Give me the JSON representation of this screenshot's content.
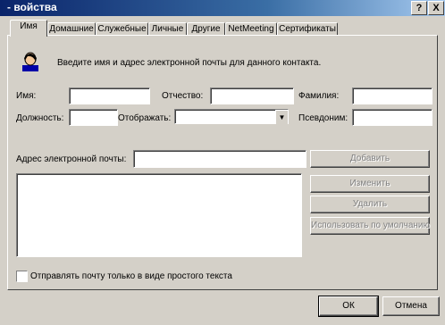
{
  "window": {
    "title": "- войства"
  },
  "titlebar_buttons": {
    "help": "?",
    "close": "X"
  },
  "tabs": [
    {
      "label": "Имя",
      "active": true
    },
    {
      "label": "Домашние"
    },
    {
      "label": "Служебные"
    },
    {
      "label": "Личные"
    },
    {
      "label": "Другие"
    },
    {
      "label": "NetMeeting"
    },
    {
      "label": "Сертификаты"
    }
  ],
  "intro": {
    "icon": "contact-person-icon",
    "text": "Введите имя и адрес электронной почты для данного контакта."
  },
  "fields": {
    "first_name": {
      "label": "Имя:",
      "value": ""
    },
    "middle_name": {
      "label": "Отчество:",
      "value": ""
    },
    "last_name": {
      "label": "Фамилия:",
      "value": ""
    },
    "title": {
      "label": "Должность:",
      "value": ""
    },
    "display": {
      "label": "Отображать:",
      "value": ""
    },
    "nickname": {
      "label": "Псевдоним:",
      "value": ""
    },
    "email": {
      "label": "Адрес электронной почты:",
      "value": ""
    }
  },
  "email_buttons": {
    "add": "Добавить",
    "edit": "Изменить",
    "remove": "Удалить",
    "default": "Использовать по умолчанию"
  },
  "plain_text": {
    "label": "Отправлять почту только в виде простого текста",
    "checked": false
  },
  "footer": {
    "ok": "ОК",
    "cancel": "Отмена"
  }
}
